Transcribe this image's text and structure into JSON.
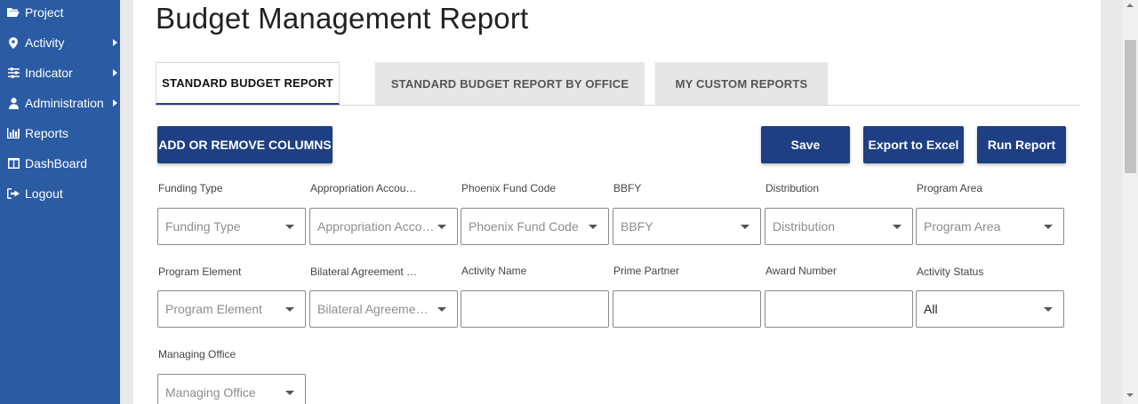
{
  "sidebar": {
    "items": [
      {
        "label": "Project",
        "icon": "folder-open-icon",
        "has_submenu": false
      },
      {
        "label": "Activity",
        "icon": "map-marker-icon",
        "has_submenu": true
      },
      {
        "label": "Indicator",
        "icon": "sliders-icon",
        "has_submenu": true
      },
      {
        "label": "Administration",
        "icon": "user-icon",
        "has_submenu": true
      },
      {
        "label": "Reports",
        "icon": "bar-chart-icon",
        "has_submenu": false
      },
      {
        "label": "DashBoard",
        "icon": "columns-icon",
        "has_submenu": false
      },
      {
        "label": "Logout",
        "icon": "sign-out-icon",
        "has_submenu": false
      }
    ]
  },
  "page": {
    "title": "Budget Management Report"
  },
  "tabs": [
    {
      "label": "STANDARD BUDGET REPORT",
      "active": true
    },
    {
      "label": "STANDARD BUDGET REPORT BY OFFICE",
      "active": false
    },
    {
      "label": "MY CUSTOM REPORTS",
      "active": false
    }
  ],
  "toolbar": {
    "add_remove_columns": "ADD OR REMOVE COLUMNS",
    "save": "Save",
    "export_excel": "Export to Excel",
    "run_report": "Run Report"
  },
  "filters": {
    "funding_type": {
      "label": "Funding Type",
      "placeholder": "Funding Type"
    },
    "appropriation_account": {
      "label": "Appropriation Accou…",
      "placeholder": "Appropriation Acco…"
    },
    "phoenix_fund_code": {
      "label": "Phoenix Fund Code",
      "placeholder": "Phoenix Fund Code"
    },
    "bbfy": {
      "label": "BBFY",
      "placeholder": "BBFY"
    },
    "distribution": {
      "label": "Distribution",
      "placeholder": "Distribution"
    },
    "program_area": {
      "label": "Program Area",
      "placeholder": "Program Area"
    },
    "program_element": {
      "label": "Program Element",
      "placeholder": "Program Element"
    },
    "bilateral_agreement": {
      "label": "Bilateral Agreement …",
      "placeholder": "Bilateral Agreemen…"
    },
    "activity_name": {
      "label": "Activity Name",
      "value": ""
    },
    "prime_partner": {
      "label": "Prime Partner",
      "value": ""
    },
    "award_number": {
      "label": "Award Number",
      "value": ""
    },
    "activity_status": {
      "label": "Activity Status",
      "value": "All"
    },
    "managing_office": {
      "label": "Managing Office",
      "placeholder": "Managing Office"
    }
  },
  "colors": {
    "sidebar": "#2a5ba3",
    "button": "#1e3f83",
    "tab_active_border": "#1e4180"
  }
}
